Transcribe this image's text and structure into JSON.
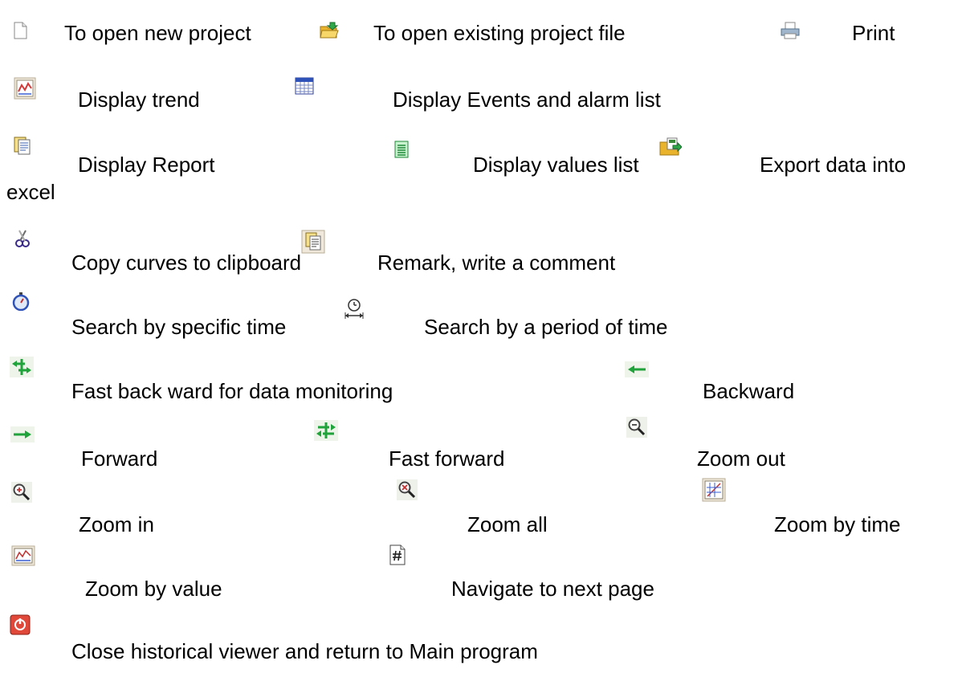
{
  "legend": {
    "new_project": "To open new project",
    "open_project": "To open existing project file",
    "print": "Print",
    "display_trend": "Display trend",
    "display_events": "Display Events and alarm list",
    "display_report": "Display Report",
    "display_values": "Display values list",
    "export_excel_line1": "Export data into",
    "export_excel_line2": "excel",
    "copy_curves": "Copy curves to clipboard",
    "remark": "Remark, write a comment",
    "search_time": "Search by specific time",
    "search_period": "Search by a period of time",
    "fast_backward": "Fast back ward for data monitoring",
    "backward": "Backward",
    "forward": "Forward",
    "fast_forward": "Fast forward",
    "zoom_out": "Zoom out",
    "zoom_in": "Zoom in",
    "zoom_all": "Zoom all",
    "zoom_time": "Zoom by time",
    "zoom_value": "Zoom by value",
    "next_page": "Navigate to next page",
    "close_viewer": "Close historical viewer and return to Main program"
  },
  "icons": [
    "new-document-icon",
    "open-folder-icon",
    "printer-icon",
    "trend-chart-icon",
    "event-list-icon",
    "report-icon",
    "values-list-icon",
    "export-excel-icon",
    "scissors-icon",
    "remark-icon",
    "stopwatch-icon",
    "time-period-icon",
    "fast-backward-icon",
    "backward-icon",
    "forward-icon",
    "fast-forward-icon",
    "zoom-out-icon",
    "zoom-in-icon",
    "zoom-all-icon",
    "zoom-by-time-icon",
    "zoom-by-value-icon",
    "next-page-icon",
    "close-viewer-icon"
  ],
  "colors": {
    "text": "#000000",
    "arrow_green": "#1fa33a",
    "folder_yellow": "#f5c842",
    "close_red": "#e0483a"
  }
}
